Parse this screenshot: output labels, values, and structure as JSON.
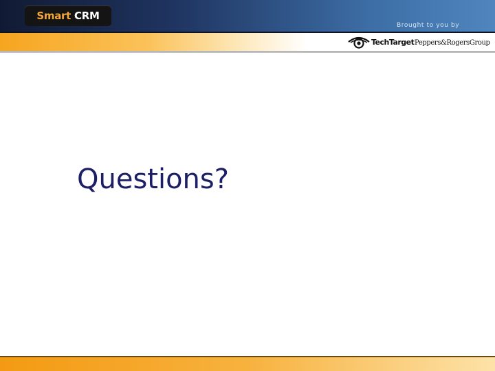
{
  "header": {
    "logo_word_1": "Smart",
    "logo_word_2": "CRM",
    "brought_by": "Brought to you by",
    "sponsors": {
      "techtarget": "TechTarget",
      "peppers_rogers": "Peppers&RogersGroup"
    }
  },
  "main": {
    "heading": "Questions?"
  },
  "colors": {
    "header_blue": "#2b4f84",
    "accent_orange": "#f6a51f",
    "heading_navy": "#1c1f66",
    "logo_orange": "#f3a73a"
  },
  "icons": {
    "techtarget_logo": "eye-icon"
  }
}
